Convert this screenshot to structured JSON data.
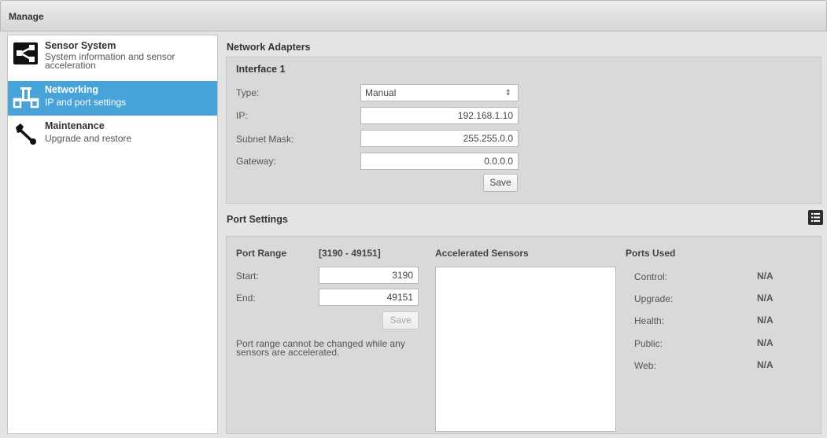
{
  "window": {
    "title": "Manage"
  },
  "sidebar": {
    "items": [
      {
        "title": "Sensor System",
        "description": "System information and sensor acceleration",
        "icon": "network-icon",
        "active": false
      },
      {
        "title": "Networking",
        "description": "IP and port settings",
        "icon": "ethernet-icon",
        "active": true
      },
      {
        "title": "Maintenance",
        "description": "Upgrade and restore",
        "icon": "wrench-icon",
        "active": false
      }
    ]
  },
  "network_adapters": {
    "heading": "Network Adapters",
    "interface_title": "Interface 1",
    "type_label": "Type:",
    "type_value": "Manual",
    "ip_label": "IP:",
    "ip_value": "192.168.1.10",
    "subnet_label": "Subnet Mask:",
    "subnet_value": "255.255.0.0",
    "gateway_label": "Gateway:",
    "gateway_value": "0.0.0.0",
    "save_label": "Save"
  },
  "port_settings": {
    "heading": "Port Settings",
    "list_icon": "list-icon",
    "port_range_label": "Port Range",
    "port_range_value": "[3190 - 49151]",
    "start_label": "Start:",
    "start_value": "3190",
    "end_label": "End:",
    "end_value": "49151",
    "save_label": "Save",
    "note": "Port range cannot be changed while any sensors are accelerated.",
    "accelerated_heading": "Accelerated Sensors",
    "ports_used_heading": "Ports Used",
    "ports_used": [
      {
        "label": "Control:",
        "value": "N/A"
      },
      {
        "label": "Upgrade:",
        "value": "N/A"
      },
      {
        "label": "Health:",
        "value": "N/A"
      },
      {
        "label": "Public:",
        "value": "N/A"
      },
      {
        "label": "Web:",
        "value": "N/A"
      }
    ]
  },
  "colors": {
    "accent": "#48a3d9",
    "panel": "#d9d9d9",
    "background": "#e4e4e4"
  }
}
